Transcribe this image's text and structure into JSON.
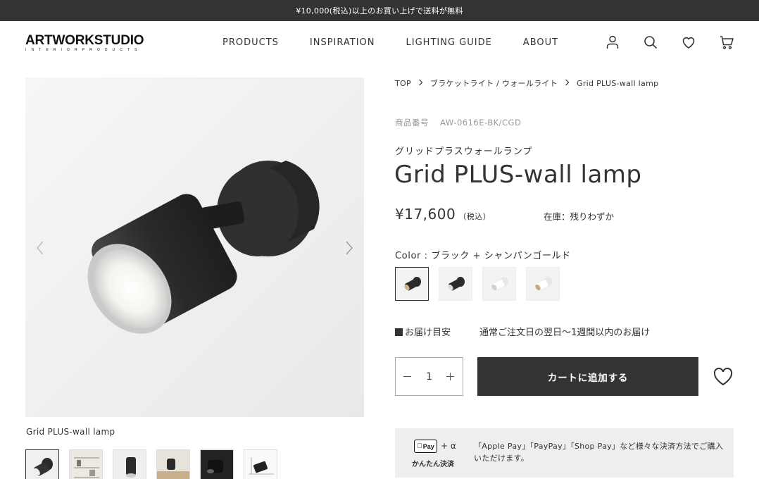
{
  "promo": {
    "text": "¥10,000(税込)以上のお買い上げで送料が無料"
  },
  "header": {
    "logo_main": "ARTWORKSTUDIO",
    "logo_sub": "INTERIORPRODUCTS",
    "nav": [
      "PRODUCTS",
      "INSPIRATION",
      "LIGHTING GUIDE",
      "ABOUT"
    ],
    "icons": [
      "account-icon",
      "search-icon",
      "heart-icon",
      "cart-icon"
    ]
  },
  "gallery": {
    "caption": "Grid PLUS-wall lamp",
    "thumbs": [
      "lamp-black",
      "shelf-scene",
      "lamp-side",
      "wood-scene",
      "lamp-dark",
      "diagram"
    ],
    "active_thumb": 0
  },
  "breadcrumb": [
    "TOP",
    "ブラケットライト / ウォールライト",
    "Grid PLUS-wall lamp"
  ],
  "product": {
    "sku_label": "商品番号",
    "sku": "AW-0616E-BK/CGD",
    "name_ja": "グリッドプラスウォールランプ",
    "name_en": "Grid PLUS-wall lamp",
    "price": "¥17,600",
    "tax": "（税込）",
    "stock": "在庫：残りわずか",
    "color_label": "Color :",
    "color_value": "ブラック + シャンパンゴールド",
    "swatches": [
      {
        "name": "black-champagne",
        "body": "#2b2b2b",
        "ring": "#c8b890"
      },
      {
        "name": "black-silver",
        "body": "#2b2b2b",
        "ring": "#d8d8d8"
      },
      {
        "name": "white-silver",
        "body": "#f4f4f4",
        "ring": "#dcdcdc"
      },
      {
        "name": "white-champagne",
        "body": "#f4f4f4",
        "ring": "#c8a87a"
      }
    ],
    "delivery_label": "お届け目安",
    "delivery_value": "通常ご注文日の翌日〜1週間以内のお届け",
    "quantity": "1",
    "add_to_cart": "カートに追加する"
  },
  "payment": {
    "apple_pay": "Pay",
    "plus_alpha": "+ α",
    "easy_pay": "かんたん決済",
    "text": "「Apple Pay」「PayPay」「Shop Pay」など様々な決済方法でご購入いただけます。"
  },
  "colors": {
    "dark": "#333333",
    "promo_bg": "#333333",
    "pay_bg": "#eeeeee"
  }
}
